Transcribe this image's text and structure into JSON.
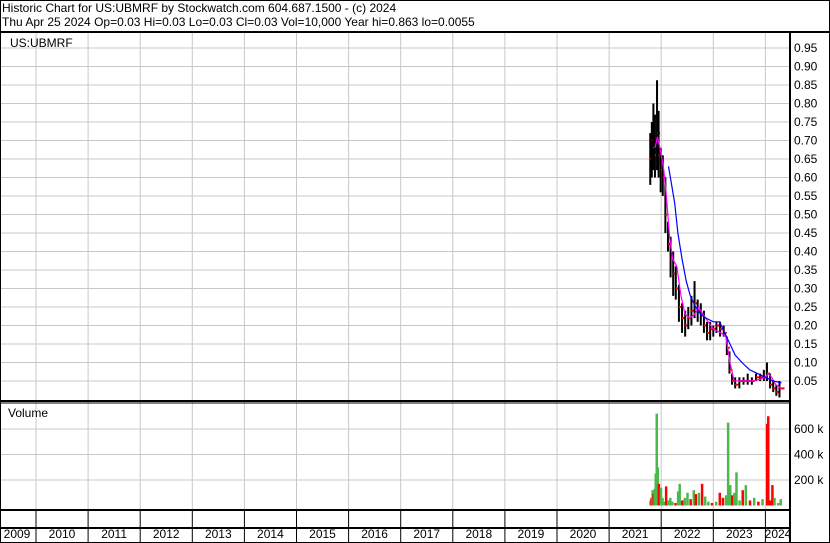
{
  "header": {
    "title": "Historic Chart for US:UBMRF by Stockwatch.com 604.687.1500 - (c) 2024",
    "quote": "Thu Apr 25 2024  Op=0.03  Hi=0.03  Lo=0.03  Cl=0.03  Vol=10,000  Year hi=0.863  lo=0.0055"
  },
  "colors": {
    "grid": "#c8c8c8",
    "bar": "#000000",
    "close": "#ff0000",
    "ma_short": "#ff00ff",
    "ma_long": "#0000ff",
    "vol_up": "#4cb84c",
    "vol_down": "#ff0000"
  },
  "chart_data": [
    {
      "type": "line",
      "title": "US:UBMRF",
      "ylim": [
        0,
        0.97
      ],
      "y_ticks": [
        "0.05",
        "0.10",
        "0.15",
        "0.20",
        "0.25",
        "0.30",
        "0.35",
        "0.40",
        "0.45",
        "0.50",
        "0.55",
        "0.60",
        "0.65",
        "0.70",
        "0.75",
        "0.80",
        "0.85",
        "0.90",
        "0.95"
      ],
      "x_ticks": [
        "2009",
        "2010",
        "2011",
        "2012",
        "2013",
        "2014",
        "2015",
        "2016",
        "2017",
        "2018",
        "2019",
        "2020",
        "2021",
        "2022",
        "2023",
        "2024"
      ],
      "grid": true,
      "price": [
        [
          2021.79,
          0.72,
          0.58,
          0.65
        ],
        [
          2021.82,
          0.75,
          0.6,
          0.7
        ],
        [
          2021.85,
          0.8,
          0.62,
          0.68
        ],
        [
          2021.88,
          0.77,
          0.6,
          0.66
        ],
        [
          2021.92,
          0.863,
          0.62,
          0.72
        ],
        [
          2021.95,
          0.78,
          0.6,
          0.66
        ],
        [
          2021.99,
          0.68,
          0.56,
          0.62
        ],
        [
          2022.03,
          0.66,
          0.55,
          0.6
        ],
        [
          2022.08,
          0.6,
          0.45,
          0.5
        ],
        [
          2022.13,
          0.48,
          0.4,
          0.42
        ],
        [
          2022.18,
          0.44,
          0.33,
          0.38
        ],
        [
          2022.23,
          0.4,
          0.28,
          0.34
        ],
        [
          2022.28,
          0.36,
          0.27,
          0.3
        ],
        [
          2022.34,
          0.31,
          0.21,
          0.25
        ],
        [
          2022.4,
          0.26,
          0.18,
          0.22
        ],
        [
          2022.46,
          0.24,
          0.17,
          0.2
        ],
        [
          2022.52,
          0.25,
          0.19,
          0.22
        ],
        [
          2022.58,
          0.28,
          0.2,
          0.24
        ],
        [
          2022.64,
          0.32,
          0.22,
          0.26
        ],
        [
          2022.7,
          0.27,
          0.21,
          0.24
        ],
        [
          2022.76,
          0.26,
          0.2,
          0.23
        ],
        [
          2022.82,
          0.24,
          0.18,
          0.2
        ],
        [
          2022.88,
          0.21,
          0.16,
          0.18
        ],
        [
          2022.94,
          0.21,
          0.16,
          0.19
        ],
        [
          2023.0,
          0.2,
          0.17,
          0.19
        ],
        [
          2023.06,
          0.21,
          0.18,
          0.2
        ],
        [
          2023.13,
          0.21,
          0.17,
          0.19
        ],
        [
          2023.2,
          0.2,
          0.17,
          0.18
        ],
        [
          2023.26,
          0.17,
          0.12,
          0.14
        ],
        [
          2023.31,
          0.13,
          0.07,
          0.08
        ],
        [
          2023.36,
          0.07,
          0.04,
          0.05
        ],
        [
          2023.42,
          0.06,
          0.03,
          0.04
        ],
        [
          2023.5,
          0.06,
          0.03,
          0.05
        ],
        [
          2023.58,
          0.06,
          0.04,
          0.05
        ],
        [
          2023.66,
          0.07,
          0.04,
          0.05
        ],
        [
          2023.74,
          0.06,
          0.04,
          0.05
        ],
        [
          2023.82,
          0.07,
          0.05,
          0.06
        ],
        [
          2023.9,
          0.07,
          0.05,
          0.06
        ],
        [
          2023.97,
          0.08,
          0.05,
          0.06
        ],
        [
          2024.03,
          0.1,
          0.05,
          0.07
        ],
        [
          2024.09,
          0.07,
          0.03,
          0.04
        ],
        [
          2024.15,
          0.05,
          0.02,
          0.03
        ],
        [
          2024.21,
          0.04,
          0.01,
          0.02
        ],
        [
          2024.27,
          0.05,
          0.0055,
          0.03
        ],
        [
          2024.31,
          0.03,
          0.03,
          0.03
        ]
      ],
      "ma_short": [
        [
          2021.88,
          0.68
        ],
        [
          2021.93,
          0.71
        ],
        [
          2021.99,
          0.67
        ],
        [
          2022.05,
          0.62
        ],
        [
          2022.1,
          0.55
        ],
        [
          2022.16,
          0.44
        ],
        [
          2022.22,
          0.38
        ],
        [
          2022.3,
          0.36
        ],
        [
          2022.38,
          0.28
        ],
        [
          2022.46,
          0.23
        ],
        [
          2022.55,
          0.22
        ],
        [
          2022.64,
          0.23
        ],
        [
          2022.72,
          0.25
        ],
        [
          2022.8,
          0.23
        ],
        [
          2022.9,
          0.21
        ],
        [
          2023.0,
          0.19
        ],
        [
          2023.15,
          0.18
        ],
        [
          2023.24,
          0.17
        ],
        [
          2023.32,
          0.1
        ],
        [
          2023.4,
          0.05
        ],
        [
          2023.55,
          0.05
        ],
        [
          2023.75,
          0.05
        ],
        [
          2023.9,
          0.055
        ],
        [
          2024.0,
          0.06
        ],
        [
          2024.06,
          0.07
        ],
        [
          2024.12,
          0.06
        ],
        [
          2024.2,
          0.04
        ],
        [
          2024.31,
          0.03
        ]
      ],
      "ma_long": [
        [
          2022.14,
          0.63
        ],
        [
          2022.2,
          0.58
        ],
        [
          2022.26,
          0.53
        ],
        [
          2022.32,
          0.45
        ],
        [
          2022.4,
          0.38
        ],
        [
          2022.48,
          0.32
        ],
        [
          2022.56,
          0.28
        ],
        [
          2022.66,
          0.25
        ],
        [
          2022.76,
          0.23
        ],
        [
          2022.86,
          0.22
        ],
        [
          2023.0,
          0.21
        ],
        [
          2023.12,
          0.21
        ],
        [
          2023.22,
          0.18
        ],
        [
          2023.32,
          0.15
        ],
        [
          2023.42,
          0.12
        ],
        [
          2023.55,
          0.1
        ],
        [
          2023.7,
          0.08
        ],
        [
          2023.85,
          0.07
        ],
        [
          2024.0,
          0.06
        ],
        [
          2024.15,
          0.05
        ],
        [
          2024.31,
          0.045
        ]
      ]
    },
    {
      "type": "bar",
      "title": "Volume",
      "ylim": [
        0,
        800000
      ],
      "y_ticks": [
        "200 k",
        "400 k",
        "600 k"
      ],
      "bars": [
        [
          2021.79,
          40000,
          "up"
        ],
        [
          2021.81,
          60000,
          "down"
        ],
        [
          2021.83,
          120000,
          "up"
        ],
        [
          2021.85,
          90000,
          "down"
        ],
        [
          2021.87,
          130000,
          "up"
        ],
        [
          2021.89,
          250000,
          "up"
        ],
        [
          2021.91,
          720000,
          "up"
        ],
        [
          2021.93,
          300000,
          "up"
        ],
        [
          2021.95,
          170000,
          "down"
        ],
        [
          2021.97,
          120000,
          "down"
        ],
        [
          2021.99,
          140000,
          "up"
        ],
        [
          2022.02,
          60000,
          "up"
        ],
        [
          2022.06,
          30000,
          "up"
        ],
        [
          2022.09,
          150000,
          "down"
        ],
        [
          2022.13,
          40000,
          "up"
        ],
        [
          2022.17,
          60000,
          "up"
        ],
        [
          2022.21,
          30000,
          "up"
        ],
        [
          2022.27,
          20000,
          "down"
        ],
        [
          2022.32,
          110000,
          "up"
        ],
        [
          2022.35,
          170000,
          "up"
        ],
        [
          2022.4,
          40000,
          "down"
        ],
        [
          2022.45,
          60000,
          "up"
        ],
        [
          2022.5,
          100000,
          "up"
        ],
        [
          2022.56,
          50000,
          "down"
        ],
        [
          2022.62,
          120000,
          "up"
        ],
        [
          2022.66,
          90000,
          "down"
        ],
        [
          2022.72,
          100000,
          "up"
        ],
        [
          2022.78,
          170000,
          "down"
        ],
        [
          2022.84,
          70000,
          "up"
        ],
        [
          2022.9,
          30000,
          "up"
        ],
        [
          2022.97,
          20000,
          "down"
        ],
        [
          2023.05,
          30000,
          "up"
        ],
        [
          2023.12,
          100000,
          "down"
        ],
        [
          2023.18,
          60000,
          "down"
        ],
        [
          2023.24,
          80000,
          "up"
        ],
        [
          2023.28,
          650000,
          "up"
        ],
        [
          2023.32,
          160000,
          "up"
        ],
        [
          2023.36,
          80000,
          "down"
        ],
        [
          2023.4,
          100000,
          "up"
        ],
        [
          2023.44,
          260000,
          "up"
        ],
        [
          2023.5,
          40000,
          "up"
        ],
        [
          2023.56,
          120000,
          "down"
        ],
        [
          2023.62,
          160000,
          "up"
        ],
        [
          2023.7,
          40000,
          "down"
        ],
        [
          2023.78,
          60000,
          "up"
        ],
        [
          2023.86,
          30000,
          "down"
        ],
        [
          2023.94,
          50000,
          "up"
        ],
        [
          2024.03,
          640000,
          "down"
        ],
        [
          2024.05,
          700000,
          "down"
        ],
        [
          2024.09,
          40000,
          "down"
        ],
        [
          2024.13,
          160000,
          "down"
        ],
        [
          2024.17,
          60000,
          "up"
        ],
        [
          2024.24,
          20000,
          "up"
        ],
        [
          2024.29,
          50000,
          "up"
        ]
      ]
    }
  ]
}
